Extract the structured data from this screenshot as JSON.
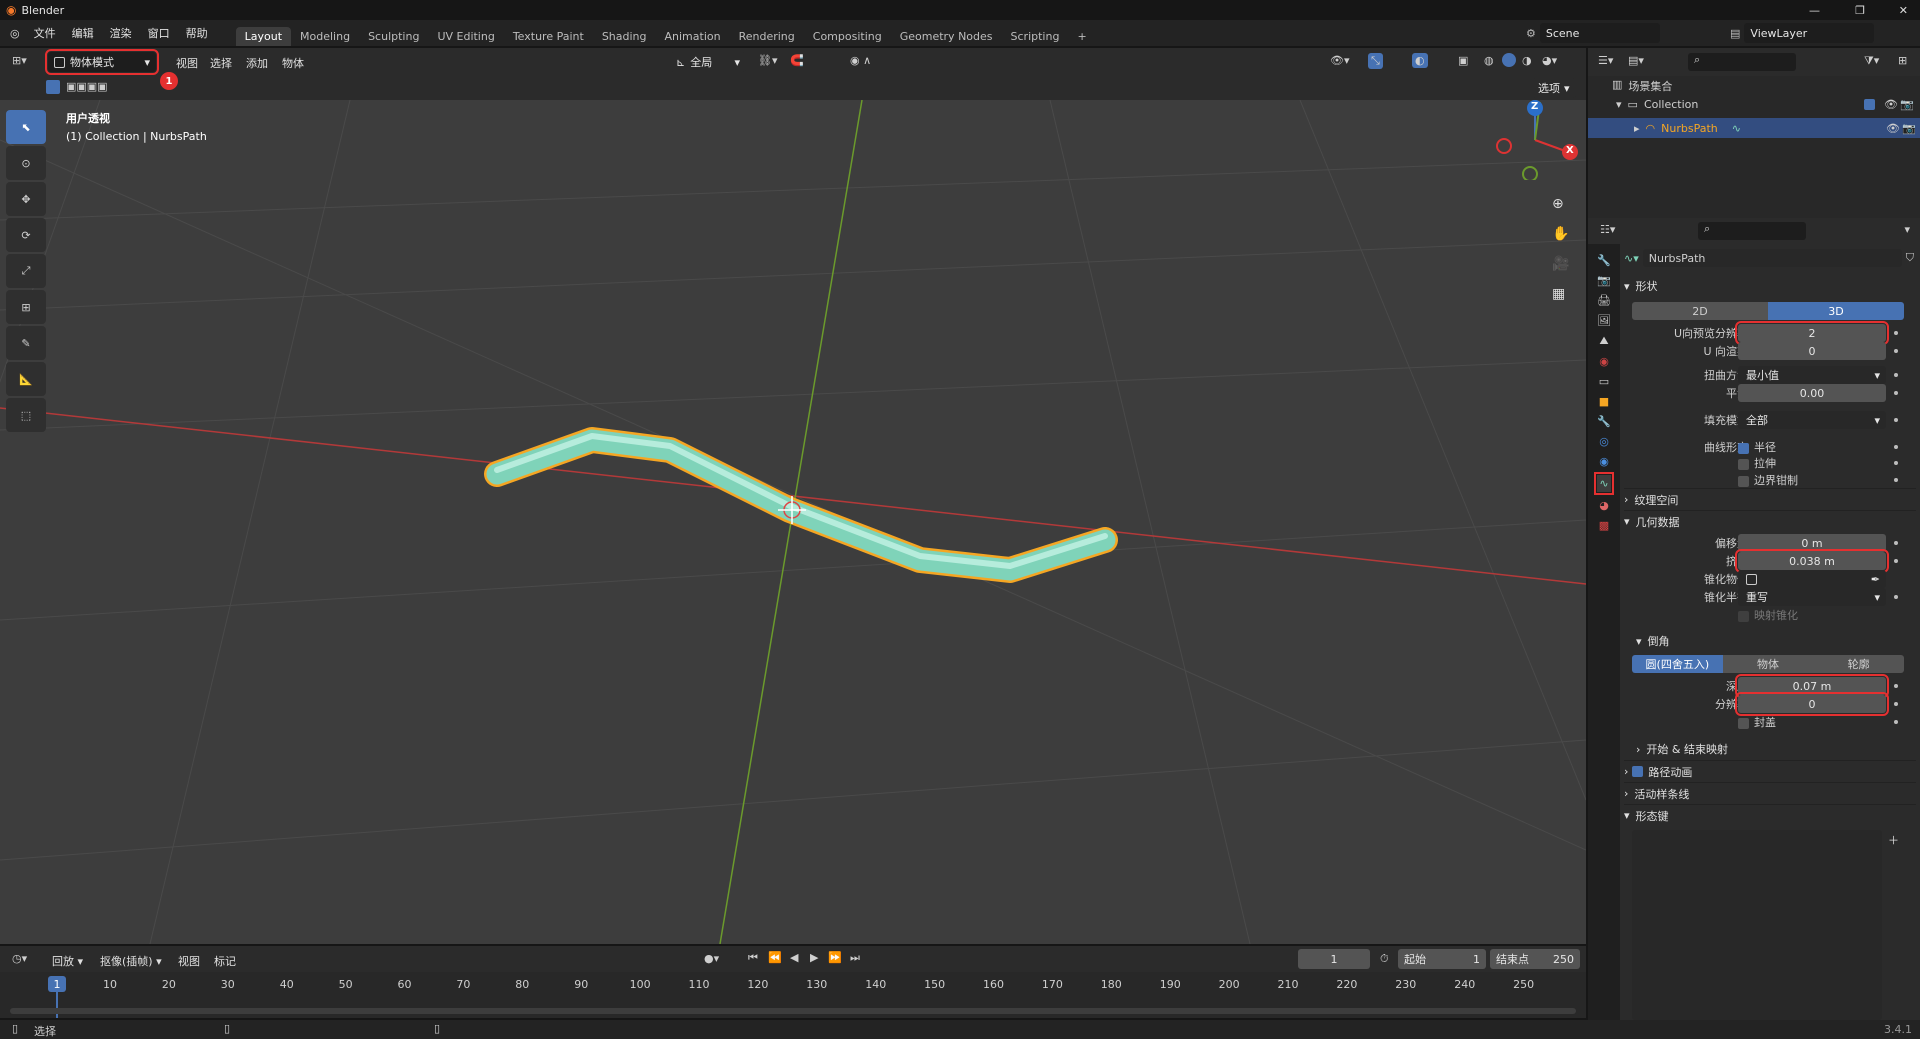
{
  "app": {
    "title": "Blender",
    "version": "3.4.1"
  },
  "menu": [
    "文件",
    "编辑",
    "渲染",
    "窗口",
    "帮助"
  ],
  "workspaces": [
    "Layout",
    "Modeling",
    "Sculpting",
    "UV Editing",
    "Texture Paint",
    "Shading",
    "Animation",
    "Rendering",
    "Compositing",
    "Geometry Nodes",
    "Scripting"
  ],
  "add_ws": "+",
  "scene": {
    "name": "Scene",
    "view_layer": "ViewLayer"
  },
  "viewport": {
    "mode": "物体模式",
    "menus": [
      "视图",
      "选择",
      "添加",
      "物体"
    ],
    "orientation": "全局",
    "options": "选项",
    "info_line1": "用户透视",
    "info_line2": "(1) Collection | NurbsPath"
  },
  "markers": {
    "m1": "1",
    "m2": "2"
  },
  "gizmo": {
    "z": "Z",
    "x": "X"
  },
  "outliner": {
    "root": "场景集合",
    "collection": "Collection",
    "object": "NurbsPath"
  },
  "props": {
    "object_name": "NurbsPath",
    "shape": {
      "title": "形状",
      "mode_2d": "2D",
      "mode_3d": "3D",
      "rows": [
        {
          "label": "U向预览分辨率",
          "value": "2"
        },
        {
          "label": "U 向渲染",
          "value": "0"
        },
        {
          "label": "扭曲方法",
          "value": "最小值"
        },
        {
          "label": "平滑",
          "value": "0.00"
        },
        {
          "label": "填充模式",
          "value": "全部"
        }
      ],
      "deform_label": "曲线形变",
      "deform_radius": "半径",
      "deform_stretch": "拉伸",
      "deform_bounds": "边界钳制"
    },
    "texspace": "纹理空间",
    "geometry": {
      "title": "几何数据",
      "rows": [
        {
          "label": "偏移量",
          "value": "0 m"
        },
        {
          "label": "挤出",
          "value": "0.038 m"
        },
        {
          "label": "锥化物体",
          "value": ""
        },
        {
          "label": "锥化半径",
          "value": "重写"
        }
      ],
      "map_taper": "映射锥化"
    },
    "bevel": {
      "title": "倒角",
      "tabs": [
        "圆(四舍五入)",
        "物体",
        "轮廓"
      ],
      "rows": [
        {
          "label": "深度",
          "value": "0.07 m"
        },
        {
          "label": "分辨率",
          "value": "0"
        }
      ],
      "cap": "封盖"
    },
    "start_end": "开始 & 结束映射",
    "path_anim": "路径动画",
    "active_spline": "活动样条线",
    "shape_keys": "形态键"
  },
  "timeline": {
    "menus": [
      "回放",
      "抠像(插帧)",
      "视图",
      "标记"
    ],
    "current": "1",
    "start_label": "起始",
    "start": "1",
    "end_label": "结束点",
    "end": "250",
    "ticks": [
      "1",
      "10",
      "20",
      "30",
      "40",
      "50",
      "60",
      "70",
      "80",
      "90",
      "100",
      "110",
      "120",
      "130",
      "140",
      "150",
      "160",
      "170",
      "180",
      "190",
      "200",
      "210",
      "220",
      "230",
      "240",
      "250"
    ]
  },
  "status": {
    "select": "选择"
  },
  "colors": {
    "accent": "#4772b3",
    "highlight": "#e53030",
    "curve": "#7fd3b9",
    "select": "#f5a623"
  }
}
